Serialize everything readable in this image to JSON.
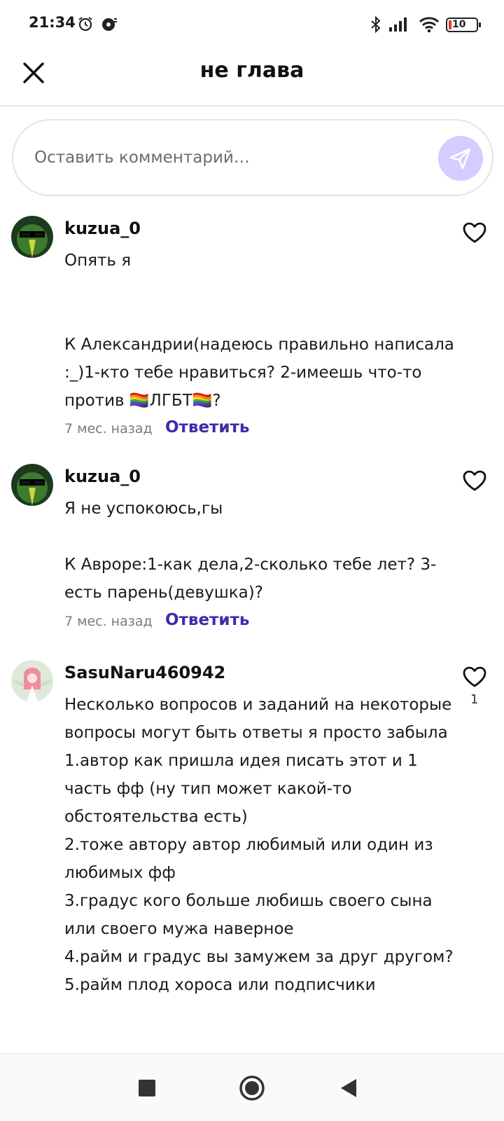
{
  "status_bar": {
    "time": "21:34",
    "battery": "10",
    "icons": [
      "alarm-icon",
      "app-notification-icon",
      "bluetooth-icon",
      "signal-icon",
      "wifi-icon",
      "battery-icon"
    ]
  },
  "header": {
    "title": "не глава",
    "close_icon": "close-icon"
  },
  "composer": {
    "placeholder": "Оставить комментарий…",
    "send_icon": "send-icon",
    "accent": "#d7ccff"
  },
  "comments": [
    {
      "username": "kuzua_0",
      "text": "Опять я\n\n\nК Александрии(надеюсь правильно написала :_)1-кто тебе нравиться? 2-имеешь что-то против 🏳️‍🌈ЛГБТ🏳️‍🌈?",
      "time": "7 мес. назад",
      "reply": "Ответить",
      "likes": ""
    },
    {
      "username": "kuzua_0",
      "text": "Я не успокоюсь,гы\n\nК Авроре:1-как дела,2-сколько тебе лет? 3-есть парень(девушка)?",
      "time": "7 мес. назад",
      "reply": "Ответить",
      "likes": ""
    },
    {
      "username": "SasuNaru460942",
      "text": "Несколько вопросов и заданий на некоторые вопросы могут быть ответы я просто забыла\n1.автор как пришла идея писать этот и 1 часть фф (ну тип может какой-то обстоятельства есть)\n2.тоже автору автор любимый или один из любимых фф\n3.градус кого больше любишь своего сына или своего мужа наверное\n4.райм и градус вы замужем за друг другом?\n5.райм плод хороса или подписчики",
      "time": "",
      "reply": "",
      "likes": "1"
    }
  ],
  "colors": {
    "reply_link": "#3f2aa8",
    "meta": "#7a7a7a"
  },
  "nav_bar": {
    "icons": [
      "recents-square-icon",
      "home-circle-icon",
      "back-triangle-icon"
    ]
  }
}
